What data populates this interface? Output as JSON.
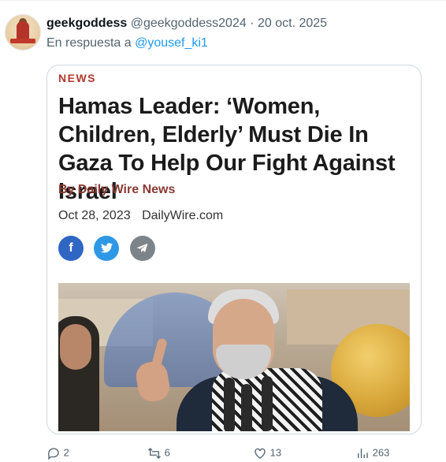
{
  "tweet": {
    "author_name": "geekgoddess",
    "author_handle": "@geekgoddess2024",
    "separator": "·",
    "date": "20 oct. 2025",
    "reply_prefix": "En respuesta a",
    "reply_to": "@yousef_ki1"
  },
  "card": {
    "kicker": "NEWS",
    "headline": "Hamas Leader: ‘Women, Children, Elderly’ Must Die In Gaza To Help Our Fight Against Israel",
    "byline": "By Daily Wire News",
    "date": "Oct 28, 2023",
    "source": "DailyWire.com",
    "share_buttons": [
      {
        "icon": "facebook-icon",
        "label": "f",
        "color": "#2f66c4"
      },
      {
        "icon": "twitter-icon",
        "color": "#2f98e6"
      },
      {
        "icon": "telegram-icon",
        "color": "#7d8489"
      }
    ]
  },
  "actions": {
    "reply_count": "2",
    "retweet_count": "6",
    "like_count": "13",
    "views_count": "263"
  },
  "colors": {
    "accent": "#1d9bf0",
    "muted_text": "#536471",
    "kicker_red": "#b0392d"
  }
}
